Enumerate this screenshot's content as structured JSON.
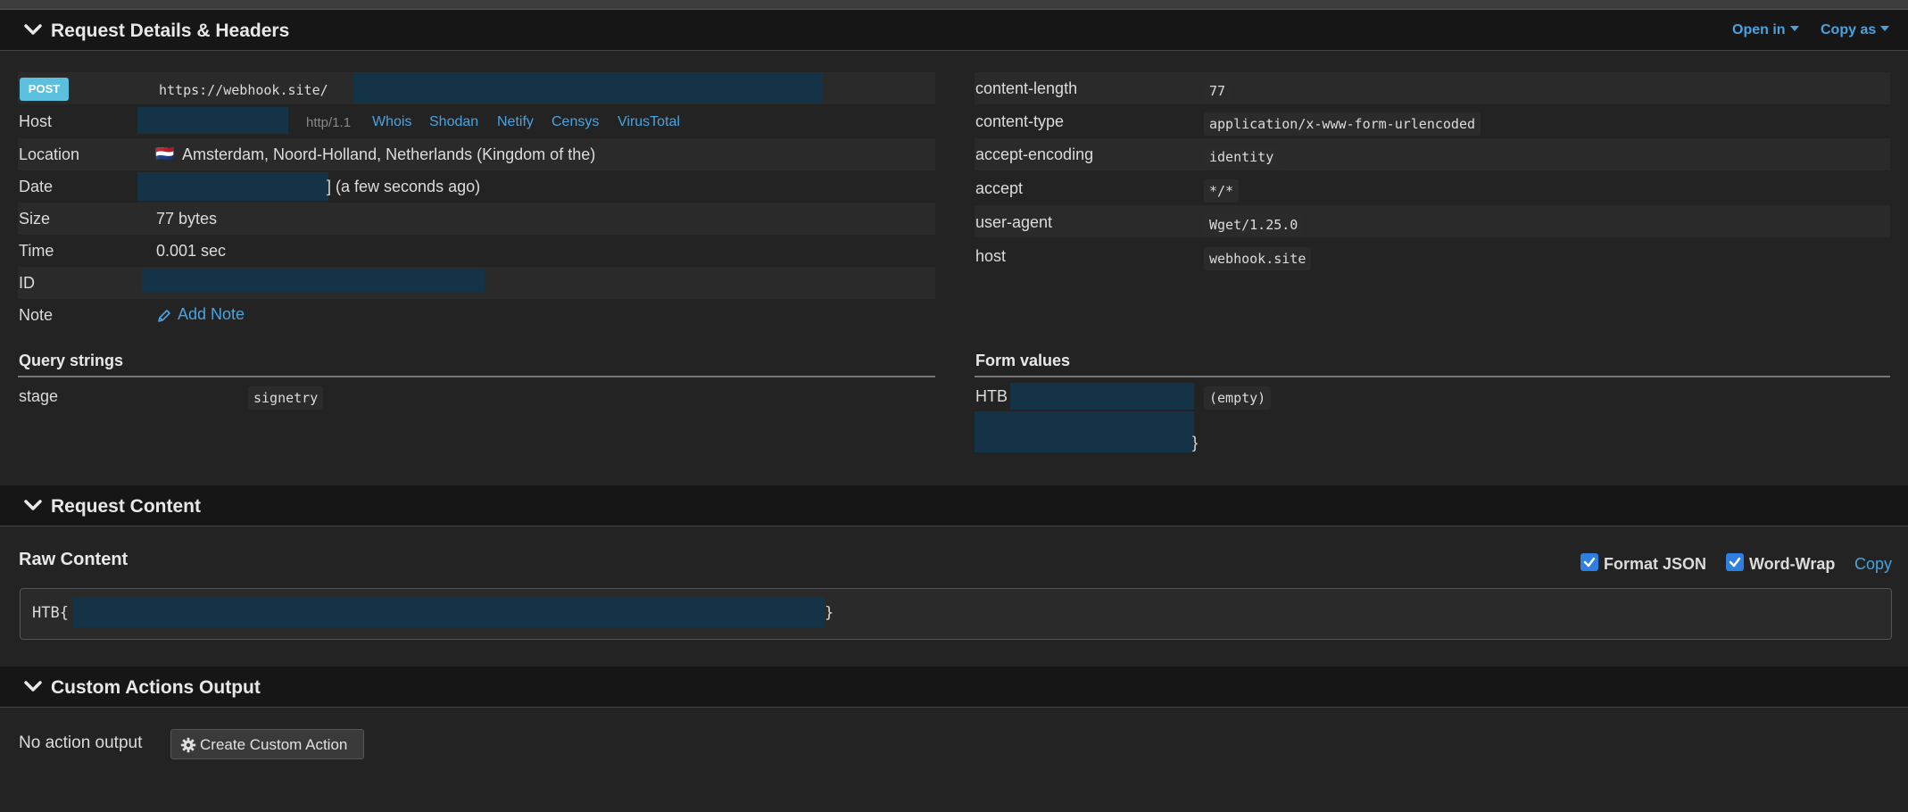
{
  "request_details": {
    "title": "Request Details & Headers",
    "open_in": "Open in",
    "copy_as": "Copy as",
    "method": "POST",
    "url": "https://webhook.site/",
    "host_label": "Host",
    "host_protocol": "http/1.1",
    "host_links": [
      "Whois",
      "Shodan",
      "Netify",
      "Censys",
      "VirusTotal"
    ],
    "location_label": "Location",
    "location_flag": "🇳🇱",
    "location_value": "Amsterdam, Noord-Holland, Netherlands (Kingdom of the)",
    "date_label": "Date",
    "date_suffix": "] (a few seconds ago)",
    "size_label": "Size",
    "size_value": "77 bytes",
    "time_label": "Time",
    "time_value": "0.001 sec",
    "id_label": "ID",
    "note_label": "Note",
    "add_note": "Add Note",
    "headers": [
      {
        "name": "content-length",
        "value": "77"
      },
      {
        "name": "content-type",
        "value": "application/x-www-form-urlencoded"
      },
      {
        "name": "accept-encoding",
        "value": "identity"
      },
      {
        "name": "accept",
        "value": "*/*"
      },
      {
        "name": "user-agent",
        "value": "Wget/1.25.0"
      },
      {
        "name": "host",
        "value": "webhook.site"
      }
    ],
    "query_strings_title": "Query strings",
    "query_strings": [
      {
        "name": "stage",
        "value": "signetry"
      }
    ],
    "form_values_title": "Form values",
    "form_values": {
      "name_prefix": "HTB",
      "value": "(empty)",
      "closing": "}"
    }
  },
  "request_content": {
    "title": "Request Content",
    "raw_title": "Raw Content",
    "format_json_label": "Format JSON",
    "format_json_checked": true,
    "word_wrap_label": "Word-Wrap",
    "word_wrap_checked": true,
    "copy_label": "Copy",
    "raw_prefix": "HTB{",
    "raw_suffix": "}"
  },
  "custom_actions": {
    "title": "Custom Actions Output",
    "no_output": "No action output",
    "create_button": "Create Custom Action"
  },
  "icons": {
    "chevron": "chevron-down-icon",
    "pencil": "pencil-icon",
    "gear": "gear-icon",
    "checkbox": "checkmark-icon"
  },
  "colors": {
    "link": "#4aa3df",
    "post_badge": "#5bc0de",
    "checkbox": "#2f7fe0",
    "redaction": "#143347"
  }
}
